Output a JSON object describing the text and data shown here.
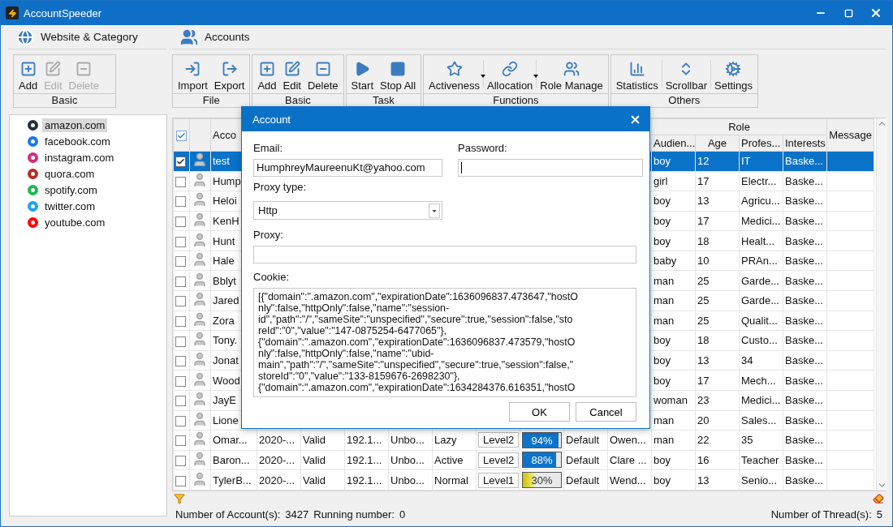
{
  "window": {
    "title": "AccountSpeeder"
  },
  "sidebar": {
    "title": "Website & Category",
    "toolbar": {
      "label": "Basic",
      "buttons": [
        {
          "kind": "add",
          "label": "Add",
          "disabled": false
        },
        {
          "kind": "edit",
          "label": "Edit",
          "disabled": true
        },
        {
          "kind": "delete",
          "label": "Delete",
          "disabled": true
        }
      ]
    },
    "items": [
      {
        "label": "amazon.com",
        "color": "#232f3e",
        "selected": true
      },
      {
        "label": "facebook.com",
        "color": "#1877f2",
        "selected": false
      },
      {
        "label": "instagram.com",
        "color": "#d62976",
        "selected": false
      },
      {
        "label": "quora.com",
        "color": "#b92b27",
        "selected": false
      },
      {
        "label": "spotify.com",
        "color": "#1db954",
        "selected": false
      },
      {
        "label": "twitter.com",
        "color": "#1da1f2",
        "selected": false
      },
      {
        "label": "youtube.com",
        "color": "#ff0000",
        "selected": false
      }
    ]
  },
  "accounts": {
    "title": "Accounts",
    "toolbar": [
      {
        "label": "File",
        "buttons": [
          {
            "kind": "import",
            "label": "Import",
            "dropdown": false
          },
          {
            "kind": "export",
            "label": "Export",
            "dropdown": false
          }
        ]
      },
      {
        "label": "Basic",
        "buttons": [
          {
            "kind": "add",
            "label": "Add",
            "dropdown": false
          },
          {
            "kind": "edit",
            "label": "Edit",
            "dropdown": false
          },
          {
            "kind": "delete",
            "label": "Delete",
            "dropdown": false
          }
        ]
      },
      {
        "label": "Task",
        "buttons": [
          {
            "kind": "start",
            "label": "Start",
            "dropdown": false
          },
          {
            "kind": "stop",
            "label": "Stop All",
            "dropdown": false
          }
        ]
      },
      {
        "label": "Functions",
        "buttons": [
          {
            "kind": "activeness",
            "label": "Activeness",
            "dropdown": true
          },
          {
            "kind": "allocation",
            "label": "Allocation",
            "dropdown": true
          },
          {
            "kind": "roles",
            "label": "Role Manage",
            "dropdown": false
          }
        ]
      },
      {
        "label": "Others",
        "buttons": [
          {
            "kind": "statistics",
            "label": "Statistics",
            "dropdown": false
          },
          {
            "kind": "scrollbar",
            "label": "Scrollbar",
            "dropdown": false
          },
          {
            "kind": "settings",
            "label": "Settings",
            "dropdown": false
          }
        ]
      }
    ],
    "table": {
      "header": {
        "all_checked": true,
        "account": "Acco",
        "role": "Role",
        "audience": "Audien...",
        "age": "Age",
        "profession": "Profes...",
        "interests": "Interests",
        "message": "Message"
      },
      "rows": [
        {
          "account": "test",
          "checked": true,
          "selected": true,
          "audience": "boy",
          "age": "12",
          "profession": "IT",
          "interests": "Baske..."
        },
        {
          "account": "Hump",
          "checked": false,
          "selected": false,
          "audience": "girl",
          "age": "17",
          "profession": "Electr...",
          "interests": "Baske..."
        },
        {
          "account": "Heloi",
          "checked": false,
          "selected": false,
          "audience": "boy",
          "age": "13",
          "profession": "Agricu...",
          "interests": "Baske..."
        },
        {
          "account": "KenH",
          "checked": false,
          "selected": false,
          "audience": "boy",
          "age": "17",
          "profession": "Medici...",
          "interests": "Baske..."
        },
        {
          "account": "Hunt",
          "checked": false,
          "selected": false,
          "audience": "boy",
          "age": "18",
          "profession": "Healt...",
          "interests": "Baske..."
        },
        {
          "account": "Hale",
          "checked": false,
          "selected": false,
          "audience": "baby",
          "age": "10",
          "profession": "PRAn...",
          "interests": "Baske..."
        },
        {
          "account": "Bblyt",
          "checked": false,
          "selected": false,
          "audience": "man",
          "age": "25",
          "profession": "Garde...",
          "interests": "Baske..."
        },
        {
          "account": "Jared",
          "checked": false,
          "selected": false,
          "audience": "man",
          "age": "25",
          "profession": "Garde...",
          "interests": "Baske..."
        },
        {
          "account": "Zora",
          "checked": false,
          "selected": false,
          "audience": "man",
          "age": "25",
          "profession": "Qualit...",
          "interests": "Baske..."
        },
        {
          "account": "Tony.",
          "checked": false,
          "selected": false,
          "audience": "boy",
          "age": "18",
          "profession": "Custo...",
          "interests": "Baske..."
        },
        {
          "account": "Jonat",
          "checked": false,
          "selected": false,
          "audience": "boy",
          "age": "13",
          "profession": "34",
          "interests": "Baske..."
        },
        {
          "account": "Wood",
          "checked": false,
          "selected": false,
          "audience": "boy",
          "age": "17",
          "profession": "Mech...",
          "interests": "Baske..."
        },
        {
          "account": "JayE",
          "checked": false,
          "selected": false,
          "audience": "woman",
          "age": "23",
          "profession": "Medici...",
          "interests": "Baske..."
        },
        {
          "account": "Lione",
          "checked": false,
          "selected": false,
          "audience": "man",
          "age": "20",
          "profession": "Sales...",
          "interests": "Baske..."
        },
        {
          "account": "Omar...",
          "checked": false,
          "selected": false,
          "created": "2020-...",
          "status": "Valid",
          "ip": "192.1...",
          "binding": "Unbo...",
          "activeness": "Lazy",
          "grade": "Level2",
          "progress": {
            "level": 0.94,
            "label": "94%"
          },
          "group": "Default",
          "name": "Owen...",
          "audience": "man",
          "age": "22",
          "profession": "35",
          "interests": "Baske..."
        },
        {
          "account": "Baron...",
          "checked": false,
          "selected": false,
          "created": "2020-...",
          "status": "Valid",
          "ip": "192.1...",
          "binding": "Unbo...",
          "activeness": "Active",
          "grade": "Level2",
          "progress": {
            "level": 0.88,
            "label": "88%"
          },
          "group": "Default",
          "name": "Clare ...",
          "audience": "boy",
          "age": "16",
          "profession": "Teacher",
          "interests": "Baske..."
        },
        {
          "account": "TylerB...",
          "checked": false,
          "selected": false,
          "created": "2020-...",
          "status": "Valid",
          "ip": "192.1...",
          "binding": "Unbo...",
          "activeness": "Normal",
          "grade": "Level1",
          "progress": {
            "level": 0.3,
            "label": "30%"
          },
          "group": "Default",
          "name": "Wend...",
          "audience": "boy",
          "age": "13",
          "profession": "Senio...",
          "interests": "Baske..."
        }
      ]
    }
  },
  "status_bar": {
    "accounts_label": "Number of Account(s):",
    "accounts": "3427",
    "running_label": "Running number:",
    "running": "0",
    "threads_label": "Number of Thread(s):",
    "threads": "5"
  },
  "dialog": {
    "title": "Account",
    "email_label": "Email:",
    "email": "HumphreyMaureenuKt@yahoo.com",
    "password_label": "Password:",
    "proxy_type_label": "Proxy type:",
    "proxy_type": "Http",
    "proxy_label": "Proxy:",
    "cookie_label": "Cookie:",
    "cookie": "[{\"domain\":\".amazon.com\",\"expirationDate\":1636096837.473647,\"hostO\nnly\":false,\"httpOnly\":false,\"name\":\"session-\nid\",\"path\":\"/\",\"sameSite\":\"unspecified\",\"secure\":true,\"session\":false,\"sto\nreId\":\"0\",\"value\":\"147-0875254-6477065\"},\n{\"domain\":\".amazon.com\",\"expirationDate\":1636096837.473579,\"hostO\nnly\":false,\"httpOnly\":false,\"name\":\"ubid-\nmain\",\"path\":\"/\",\"sameSite\":\"unspecified\",\"secure\":true,\"session\":false,\"\nstoreId\":\"0\",\"value\":\"133-8159676-2698230\"},\n{\"domain\":\".amazon.com\",\"expirationDate\":1634284376.616351,\"hostO",
    "buttons": [
      "OK",
      "Cancel"
    ]
  }
}
